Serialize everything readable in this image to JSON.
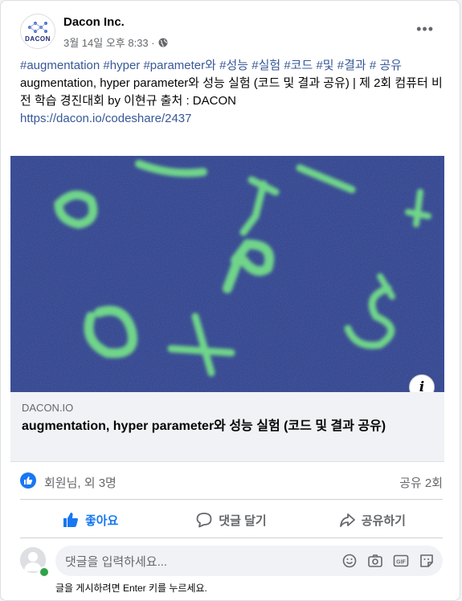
{
  "post": {
    "author": "Dacon Inc.",
    "avatar_text": "DACON",
    "timestamp": "3월 14일 오후 8:33 ·",
    "hashtags": "#augmentation #hyper #parameter와 #성능 #실험 #코드 #및 #결과 # 공유",
    "body": "augmentation, hyper parameter와 성능 실험 (코드 및 결과 공유) | 제 2회 컴퓨터 비전 학습 경진대회 by 이현규 출처 : DACON",
    "link_url": "https://dacon.io/codeshare/2437"
  },
  "link_preview": {
    "domain": "DACON.IO",
    "title": "augmentation, hyper parameter와 성능 실험 (코드 및 결과 공유)",
    "info_label": "i"
  },
  "reactions": {
    "summary": "회원님, 외 3명",
    "shares": "공유 2회"
  },
  "actions": {
    "like": "좋아요",
    "comment": "댓글 달기",
    "share": "공유하기"
  },
  "comment": {
    "placeholder": "댓글을 입력하세요...",
    "hint": "글을 게시하려면 Enter 키를 누르세요."
  },
  "colors": {
    "link": "#385898",
    "accent": "#1877f2",
    "image_bg": "#2e3f8a",
    "glyph": "#5ed08a"
  },
  "icons": [
    "globe-icon",
    "more-icon",
    "like-icon",
    "comment-icon",
    "share-icon",
    "emoji-icon",
    "camera-icon",
    "gif-icon",
    "sticker-icon",
    "info-icon"
  ]
}
